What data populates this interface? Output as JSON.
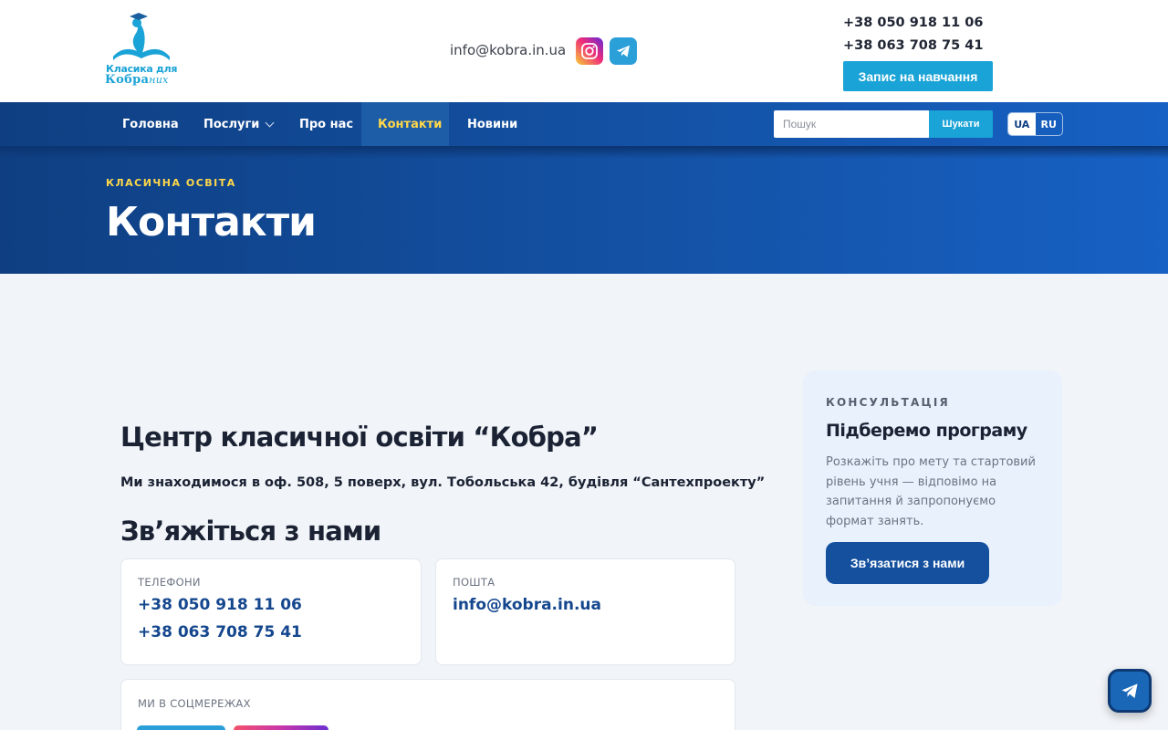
{
  "header": {
    "logo_line1": "Класика для",
    "logo_line2_prefix": "Кобра",
    "logo_line2_suffix": "них",
    "email": "info@kobra.in.ua",
    "phones": [
      "+38 050 918 11 06",
      "+38 063 708 75 41"
    ],
    "enroll_label": "Запис на навчання",
    "icons": {
      "instagram": "instagram-icon",
      "telegram": "telegram-icon"
    }
  },
  "nav": {
    "items": [
      {
        "label": "Головна",
        "active": false
      },
      {
        "label": "Послуги",
        "active": false,
        "has_dropdown": true
      },
      {
        "label": "Про нас",
        "active": false
      },
      {
        "label": "Контакти",
        "active": true
      },
      {
        "label": "Новини",
        "active": false
      }
    ],
    "search_placeholder": "Пошук",
    "search_button": "Шукати",
    "languages": [
      {
        "code": "UA",
        "selected": true
      },
      {
        "code": "RU",
        "selected": false
      }
    ]
  },
  "hero": {
    "kicker": "КЛАСИЧНА ОСВІТА",
    "title": "Контакти"
  },
  "main": {
    "center_title": "Центр класичної освіти “Кобра”",
    "address": "Ми знаходимося в оф. 508, 5 поверх, вул. Тобольська 42, будівля “Сантехпроекту”",
    "contact_title": "Зв’яжіться з нами",
    "phones_card": {
      "label": "ТЕЛЕФОНИ",
      "values": [
        "+38 050 918 11 06",
        "+38 063 708 75 41"
      ]
    },
    "email_card": {
      "label": "ПОШТА",
      "value": "info@kobra.in.ua"
    },
    "social_card": {
      "label": "МИ В СОЦМЕРЕЖАХ"
    }
  },
  "sidebar": {
    "kicker": "КОНСУЛЬТАЦІЯ",
    "title": "Підберемо програму",
    "text": "Розкажіть про мету та стартовий рівень учня — відповімо на запитання й запропонуємо формат занять.",
    "button": "Зв’язатися з нами"
  },
  "colors": {
    "accent": "#1aa3d6",
    "nav_bg": "#0f3f82",
    "highlight": "#ffd84a",
    "link": "#15478e"
  }
}
